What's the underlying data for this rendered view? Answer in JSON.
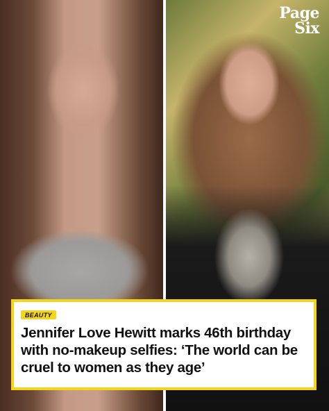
{
  "logo": {
    "line1": "Page",
    "line2": "Six"
  },
  "category_badge": "BEAUTY",
  "headline": "Jennifer Love Hewitt marks 46th birthday with no-makeup selfies: ‘The world can be cruel to women as they age’",
  "colors": {
    "accent": "#f2d51c",
    "text": "#111111",
    "card_background": "#ffffff"
  }
}
